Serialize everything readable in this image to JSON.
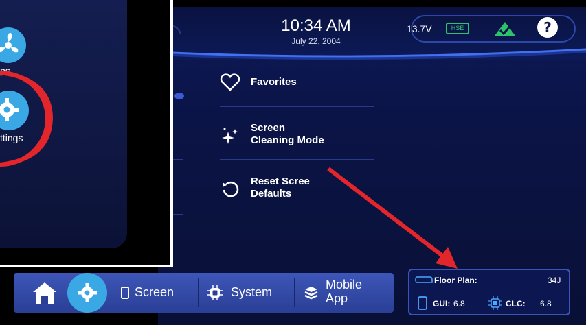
{
  "status_bar": {
    "time": "10:34 AM",
    "date": "July 22, 2004",
    "voltage": "13.7V",
    "hse_badge": "HSE",
    "colors": {
      "accent": "#2ec26a",
      "pill_border": "#2d46a8"
    }
  },
  "menu": {
    "favorites": "Favorites",
    "screen_cleaning_line1": "Screen",
    "screen_cleaning_line2": "Cleaning Mode",
    "reset_line1": "Reset Scree",
    "reset_line2": "Defaults"
  },
  "inset": {
    "partial_label_1": "ps",
    "partial_label_2": "ttings"
  },
  "nav": {
    "screen_label": "Screen",
    "system_label": "System",
    "mobile_app_line1": "Mobile",
    "mobile_app_line2": "App"
  },
  "info": {
    "floor_plan_label": "Floor Plan:",
    "floor_plan_value": "34J",
    "gui_label": "GUI:",
    "gui_value": "6.8",
    "clc_label": "CLC:",
    "clc_value": "6.8"
  },
  "icons": [
    "home-icon",
    "gear-icon",
    "phone-icon",
    "chip-icon",
    "stack-icon",
    "heart-icon",
    "sparkle-icon",
    "reset-icon",
    "check-icon",
    "help-icon",
    "fan-icon",
    "trailer-icon",
    "tablet-icon"
  ],
  "annotation_color": "#e3262b"
}
